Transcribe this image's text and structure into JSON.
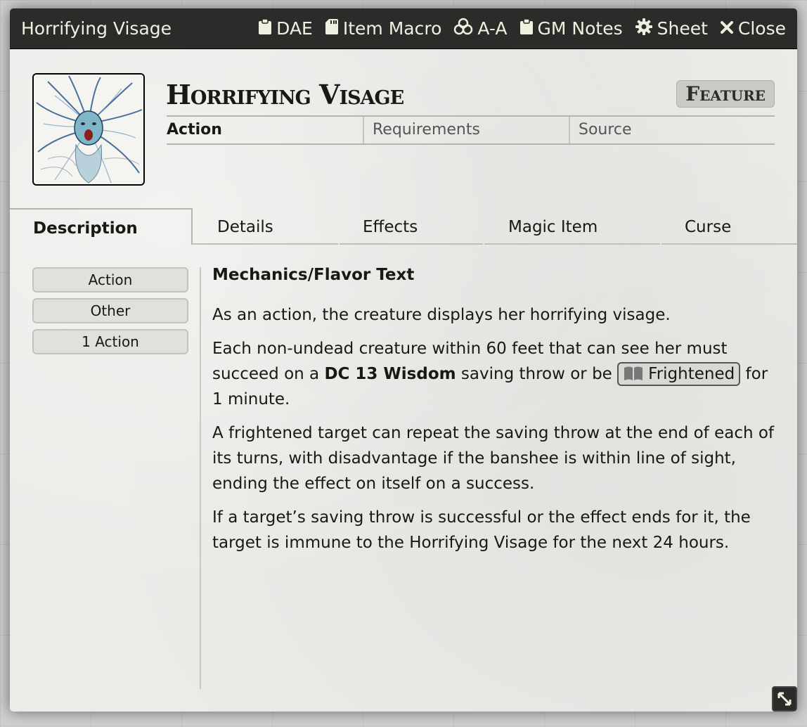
{
  "window": {
    "title": "Horrifying Visage",
    "buttons": [
      {
        "label": "DAE",
        "icon": "clipboard-icon"
      },
      {
        "label": "Item Macro",
        "icon": "sd-card-icon"
      },
      {
        "label": "A-A",
        "icon": "biohazard-icon"
      },
      {
        "label": "GM Notes",
        "icon": "clipboard-icon"
      },
      {
        "label": "Sheet",
        "icon": "gear-icon"
      },
      {
        "label": "Close",
        "icon": "close-icon"
      }
    ]
  },
  "item": {
    "name": "Horrifying Visage",
    "type": "Feature",
    "summary": [
      "Action",
      "Requirements",
      "Source"
    ],
    "portrait_icon": "banshee-portrait"
  },
  "tabs": [
    {
      "label": "Description",
      "active": true
    },
    {
      "label": "Details",
      "active": false
    },
    {
      "label": "Effects",
      "active": false
    },
    {
      "label": "Magic Item",
      "active": false
    },
    {
      "label": "Curse",
      "active": false
    }
  ],
  "properties": [
    "Action",
    "Other",
    "1 Action"
  ],
  "description": {
    "heading": "Mechanics/Flavor Text",
    "p1": "As an action, the creature displays her horrifying visage.",
    "p2_before": "Each non-undead creature within 60 feet that can see her must succeed on a ",
    "p2_bold": "DC 13 Wisdom",
    "p2_middle": " saving throw or be ",
    "p2_link": "Frightened",
    "p2_link_icon": "book-icon",
    "p2_after": " for 1 minute.",
    "p3": "A frightened target can repeat the saving throw at the end of each of its turns, with disadvantage if the banshee is within line of sight, ending the effect on itself on a success.",
    "p4": "If a target’s saving throw is successful or the effect ends for it, the target is immune to the Horrifying Visage for the next 24 hours."
  },
  "colors": {
    "header_bg": "#2b2b29",
    "sheet_bg": "#ebebe8",
    "text": "#191813"
  }
}
